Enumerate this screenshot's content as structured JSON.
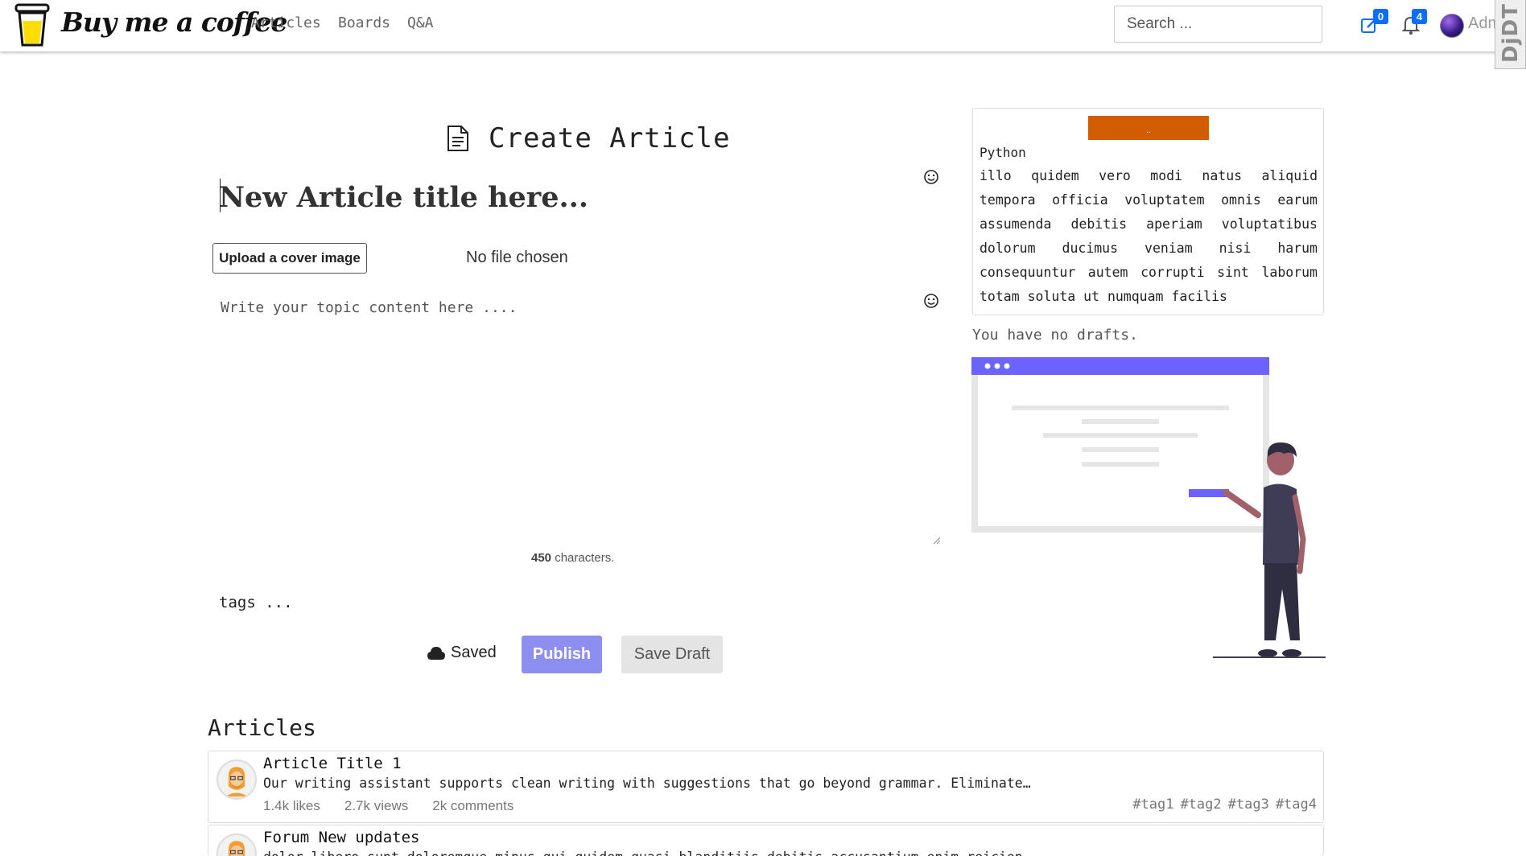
{
  "navbar": {
    "brand": "Buy me a coffee",
    "links": [
      "Articles",
      "Boards",
      "Q&A"
    ],
    "search_placeholder": "Search ...",
    "messages_count": "0",
    "notifications_count": "4",
    "username": "Admin",
    "debug_toolbar_label": "DjDT",
    "accent_color": "#0d6efd"
  },
  "form": {
    "heading": "Create Article",
    "title_placeholder": "New Article title here...",
    "upload_label": "Upload a cover image",
    "file_status": "No file chosen",
    "content_placeholder": "Write your topic content here ....",
    "char_count": "450",
    "char_suffix": " characters.",
    "tags_placeholder": "tags ...",
    "saved_label": "Saved",
    "publish_label": "Publish",
    "draft_label": "Save Draft",
    "publish_color": "#8c8ef0"
  },
  "sidebar": {
    "banner_text": "..",
    "banner_color": "#d25c02",
    "language": "Python",
    "description": "illo quidem vero modi natus aliquid tempora officia voluptatem omnis earum assumenda debitis aperiam voluptatibus dolorum ducimus veniam nisi harum consequuntur autem corrupti sint laborum totam soluta ut numquam facilis",
    "no_drafts": "You have no drafts."
  },
  "articles": {
    "heading": "Articles",
    "items": [
      {
        "title": "Article Title 1",
        "excerpt": "Our writing assistant supports clean writing with suggestions that go beyond grammar. Eliminate…",
        "likes": "1.4k likes",
        "views": "2.7k views",
        "comments": "2k comments",
        "tags": [
          "#tag1",
          "#tag2",
          "#tag3",
          "#tag4"
        ]
      },
      {
        "title": "Forum New updates",
        "excerpt": "dolor libero sunt doloremque minus qui quidem quasi blanditiis debitis accusantium enim reicien"
      }
    ]
  }
}
